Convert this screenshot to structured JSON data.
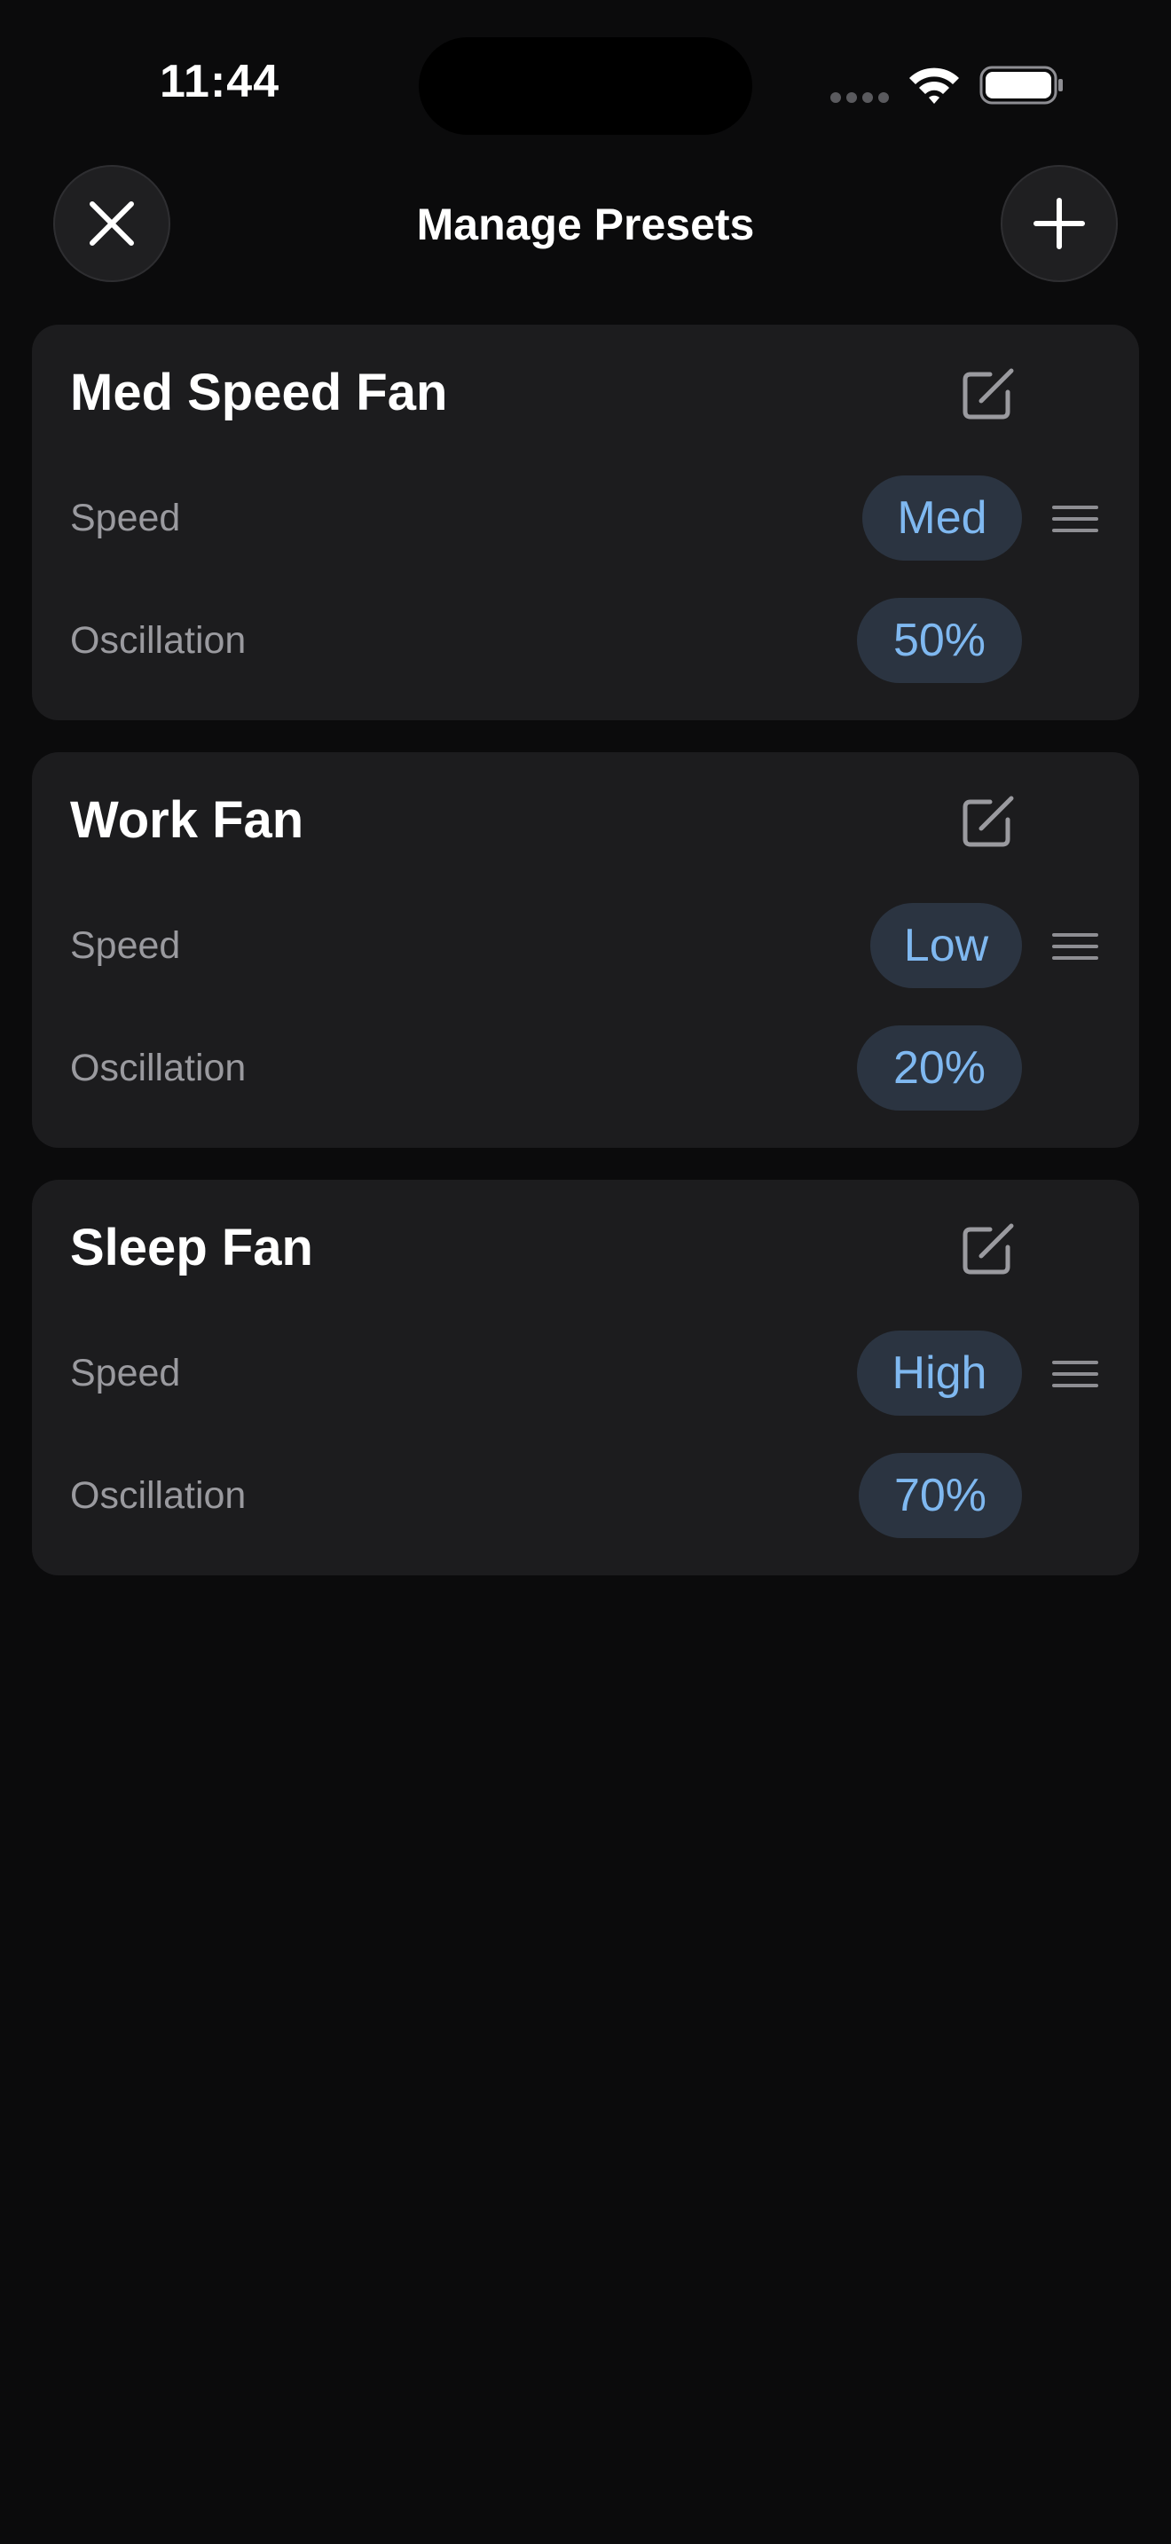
{
  "status_bar": {
    "time": "11:44",
    "icons": [
      "cellular-signal-icon",
      "wifi-icon",
      "battery-icon"
    ]
  },
  "header": {
    "title": "Manage Presets",
    "close_icon": "close-icon",
    "add_icon": "plus-icon"
  },
  "presets": [
    {
      "name": "Med Speed Fan",
      "speed_label": "Speed",
      "speed_value": "Med",
      "oscillation_label": "Oscillation",
      "oscillation_value": "50%"
    },
    {
      "name": "Work Fan",
      "speed_label": "Speed",
      "speed_value": "Low",
      "oscillation_label": "Oscillation",
      "oscillation_value": "20%"
    },
    {
      "name": "Sleep Fan",
      "speed_label": "Speed",
      "speed_value": "High",
      "oscillation_label": "Oscillation",
      "oscillation_value": "70%"
    }
  ],
  "colors": {
    "background": "#0b0b0c",
    "card": "#1c1c1e",
    "pill_background": "#2b3441",
    "pill_text": "#7fb8f0",
    "label_text": "#9a9a9f"
  }
}
